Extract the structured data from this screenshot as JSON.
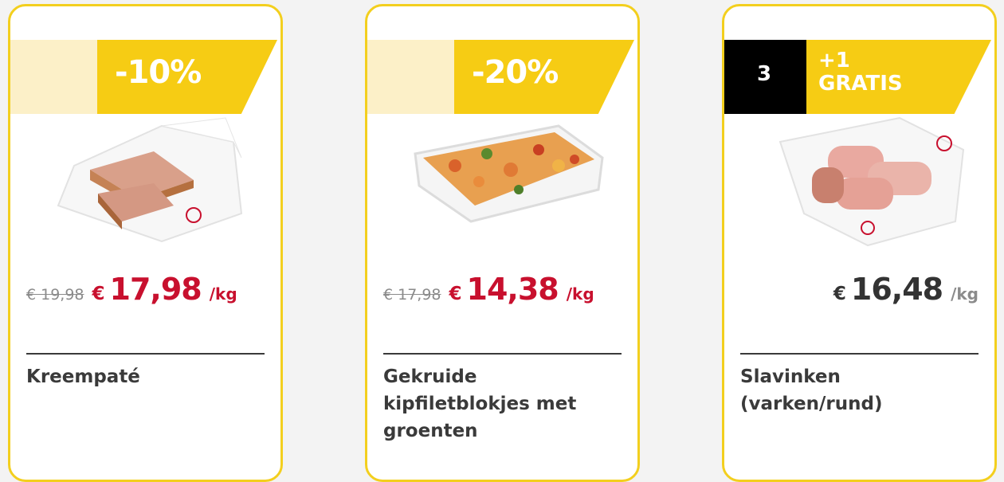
{
  "products": [
    {
      "badge": "-10%",
      "old_price": "€ 19,98",
      "currency": "€",
      "price": "17,98",
      "unit": "/kg",
      "name": "Kreempaté",
      "image": "kreempate-icon"
    },
    {
      "badge": "-20%",
      "old_price": "€ 17,98",
      "currency": "€",
      "price": "14,38",
      "unit": "/kg",
      "name": "Gekruide kipfiletblokjes met groenten",
      "image": "kipfiletblokjes-icon"
    },
    {
      "badge_count": "3",
      "badge_plus": "+1",
      "badge_free": "GRATIS",
      "currency": "€",
      "price": "16,48",
      "unit": "/kg",
      "name": "Slavinken (varken/rund)",
      "image": "slavinken-icon"
    }
  ],
  "colors": {
    "accent_yellow": "#f6cc14",
    "border_yellow": "#f3cf1e",
    "sale_red": "#c8102e",
    "text_dark": "#3a3a3a"
  }
}
